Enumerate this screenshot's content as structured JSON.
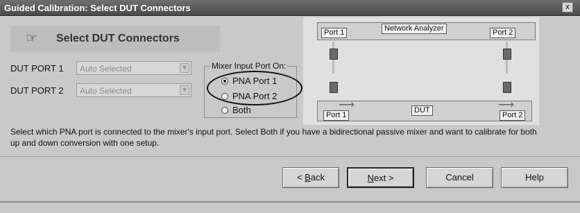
{
  "window": {
    "title": "Guided Calibration: Select DUT Connectors",
    "close_label": "x"
  },
  "header": {
    "label": "Select DUT Connectors",
    "icon": "hand-pointer-icon"
  },
  "dut_port1": {
    "label": "DUT PORT 1",
    "value": "Auto Selected"
  },
  "dut_port2": {
    "label": "DUT PORT 2",
    "value": "Auto Selected"
  },
  "mixer_group": {
    "legend": "Mixer Input Port On:",
    "options": [
      "PNA Port 1",
      "PNA Port 2",
      "Both"
    ],
    "selected": "PNA Port 1"
  },
  "diagram": {
    "analyzer_label": "Network Analyzer",
    "analyzer_port1": "Port 1",
    "analyzer_port2": "Port 2",
    "dut_label": "DUT",
    "dut_port1": "Port 1",
    "dut_port2": "Port 2"
  },
  "description": "Select which PNA port is connected to the mixer's input port.  Select Both if you have a bidirectional passive mixer and want to calibrate for both up and down conversion with one setup.",
  "buttons": {
    "back_mnemonic": "B",
    "back_rest": "ack",
    "back_prefix": "< ",
    "next_mnemonic": "N",
    "next_rest": "ext >",
    "cancel": "Cancel",
    "help": "Help"
  }
}
